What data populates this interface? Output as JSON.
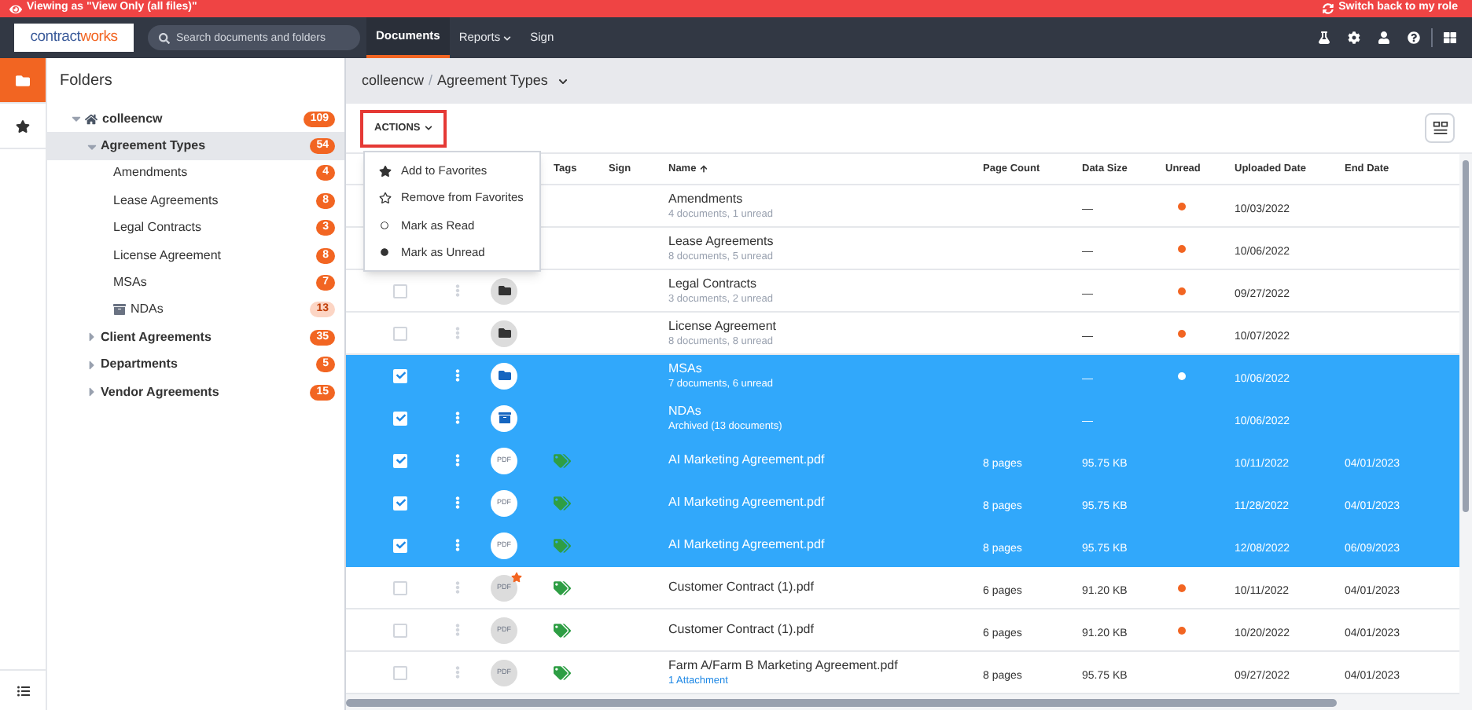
{
  "banner": {
    "viewing": "Viewing as \"View Only (all files)\"",
    "switch": "Switch back to my role"
  },
  "nav": {
    "logo": [
      "contract",
      "works"
    ],
    "search": {
      "placeholder": "Search documents and folders"
    },
    "tabs": [
      {
        "label": "Documents",
        "selected": true,
        "has_menu": false
      },
      {
        "label": "Reports",
        "selected": false,
        "has_menu": true
      },
      {
        "label": "Sign",
        "selected": false,
        "has_menu": false
      }
    ]
  },
  "rail": [
    {
      "selected": true
    },
    {
      "selected": false
    }
  ],
  "folders": {
    "title": "Folders",
    "tree": [
      {
        "label": "colleencw",
        "count": "109",
        "kind": "home",
        "selected": false,
        "expanded": true,
        "children": [
          {
            "label": "Agreement Types",
            "count": "54",
            "selected": true,
            "expanded": true,
            "children": [
              {
                "label": "Amendments",
                "count": "4",
                "selected": false
              },
              {
                "label": "Lease Agreements",
                "count": "8",
                "selected": false
              },
              {
                "label": "Legal Contracts",
                "count": "3",
                "selected": false
              },
              {
                "label": "License Agreement",
                "count": "8",
                "selected": false
              },
              {
                "label": "MSAs",
                "count": "7",
                "selected": false
              },
              {
                "label": "NDAs",
                "count": "13",
                "kind": "archive",
                "selected": false
              }
            ]
          },
          {
            "label": "Client Agreements",
            "count": "35",
            "selected": false,
            "expanded": false
          },
          {
            "label": "Departments",
            "count": "5",
            "selected": false,
            "expanded": false
          },
          {
            "label": "Vendor Agreements",
            "count": "15",
            "selected": false,
            "expanded": false
          }
        ]
      }
    ]
  },
  "breadcrumb": {
    "items": [
      "colleencw",
      "Agreement Types"
    ],
    "separator": "/"
  },
  "actions": {
    "label": "ACTIONS",
    "open": true,
    "menu": [
      "Add to Favorites",
      "Remove from Favorites",
      "Mark as Read",
      "Mark as Unread"
    ]
  },
  "table": {
    "columns": [
      {
        "label": "Tags",
        "sorted": false
      },
      {
        "label": "Sign",
        "sorted": false
      },
      {
        "label": "Name",
        "sorted": true
      },
      {
        "label": "Page Count",
        "sorted": false
      },
      {
        "label": "Data Size",
        "sorted": false
      },
      {
        "label": "Unread",
        "sorted": false
      },
      {
        "label": "Uploaded Date",
        "sorted": false
      },
      {
        "label": "End Date",
        "sorted": false
      }
    ],
    "rows": [
      {
        "name": "Amendments",
        "detail": {
          "text": "4 documents, 1 unread",
          "kind": "note"
        },
        "size": "—",
        "unread": true,
        "uploaded": "10/03/2022",
        "selected": false,
        "tagged": false
      },
      {
        "name": "Lease Agreements",
        "detail": {
          "text": "8 documents, 5 unread",
          "kind": "note"
        },
        "size": "—",
        "unread": true,
        "uploaded": "10/06/2022",
        "selected": false,
        "tagged": false
      },
      {
        "name": "Legal Contracts",
        "detail": {
          "text": "3 documents, 2 unread",
          "kind": "note"
        },
        "kind": "folder",
        "checked": false,
        "size": "—",
        "unread": true,
        "uploaded": "09/27/2022",
        "selected": false,
        "tagged": false
      },
      {
        "name": "License Agreement",
        "detail": {
          "text": "8 documents, 8 unread",
          "kind": "note"
        },
        "kind": "folder",
        "checked": false,
        "size": "—",
        "unread": true,
        "uploaded": "10/07/2022",
        "selected": false,
        "tagged": false
      },
      {
        "name": "MSAs",
        "detail": {
          "text": "7 documents, 6 unread",
          "kind": "note"
        },
        "kind": "folder",
        "checked": true,
        "size": "—",
        "unread": true,
        "uploaded": "10/06/2022",
        "selected": true,
        "tagged": false
      },
      {
        "name": "NDAs",
        "detail": {
          "text": "Archived (13 documents)",
          "kind": "note"
        },
        "kind": "archive",
        "checked": true,
        "size": "—",
        "unread": false,
        "uploaded": "10/06/2022",
        "selected": true,
        "tagged": false
      },
      {
        "name": "AI Marketing Agreement.pdf",
        "kind": "file",
        "file_type": "PDF",
        "favorite": false,
        "checked": true,
        "pages": "8 pages",
        "size": "95.75 KB",
        "unread": false,
        "uploaded": "10/11/2022",
        "end": "04/01/2023",
        "selected": true,
        "tagged": true
      },
      {
        "name": "AI Marketing Agreement.pdf",
        "kind": "file",
        "file_type": "PDF",
        "favorite": false,
        "checked": true,
        "pages": "8 pages",
        "size": "95.75 KB",
        "unread": false,
        "uploaded": "11/28/2022",
        "end": "04/01/2023",
        "selected": true,
        "tagged": true
      },
      {
        "name": "AI Marketing Agreement.pdf",
        "kind": "file",
        "file_type": "PDF",
        "favorite": false,
        "checked": true,
        "pages": "8 pages",
        "size": "95.75 KB",
        "unread": false,
        "uploaded": "12/08/2022",
        "end": "06/09/2023",
        "selected": true,
        "tagged": true
      },
      {
        "name": "Customer Contract (1).pdf",
        "kind": "file",
        "file_type": "PDF",
        "favorite": true,
        "checked": false,
        "pages": "6 pages",
        "size": "91.20 KB",
        "unread": true,
        "uploaded": "10/11/2022",
        "end": "04/01/2023",
        "selected": false,
        "tagged": true
      },
      {
        "name": "Customer Contract (1).pdf",
        "kind": "file",
        "file_type": "PDF",
        "favorite": false,
        "checked": false,
        "pages": "6 pages",
        "size": "91.20 KB",
        "unread": true,
        "uploaded": "10/20/2022",
        "end": "04/01/2023",
        "selected": false,
        "tagged": true
      },
      {
        "name": "Farm A/Farm B Marketing Agreement.pdf",
        "detail": {
          "text": "1 Attachment",
          "kind": "link"
        },
        "kind": "file",
        "file_type": "PDF",
        "favorite": false,
        "checked": false,
        "pages": "8 pages",
        "size": "95.75 KB",
        "unread": false,
        "uploaded": "09/27/2022",
        "end": "04/01/2023",
        "selected": false,
        "tagged": true
      }
    ]
  }
}
